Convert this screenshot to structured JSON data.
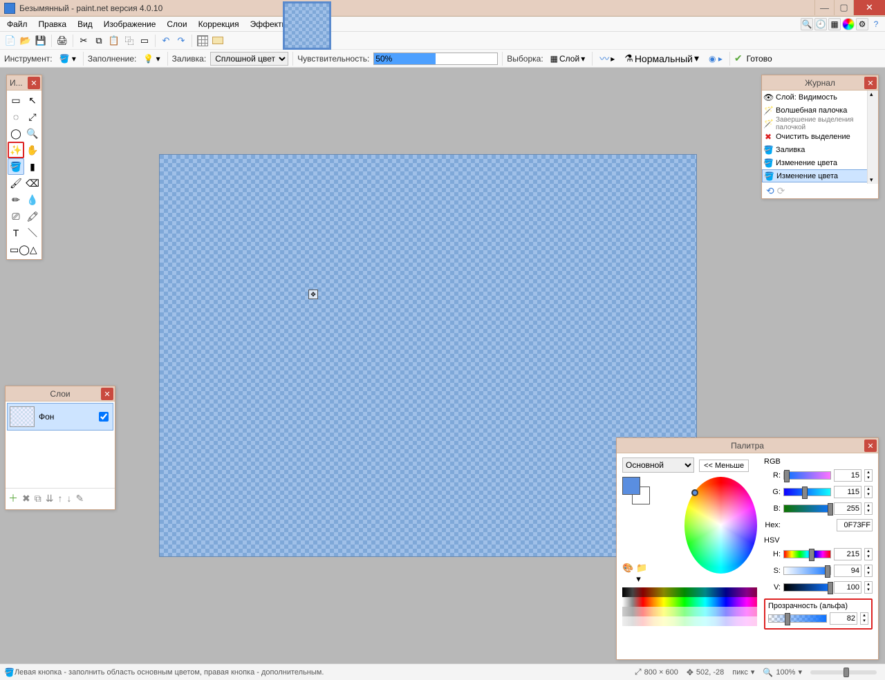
{
  "title": "Безымянный - paint.net версия 4.0.10",
  "menu": [
    "Файл",
    "Правка",
    "Вид",
    "Изображение",
    "Слои",
    "Коррекция",
    "Эффекты"
  ],
  "toolbar2": {
    "tool_label": "Инструмент:",
    "fillmode_label": "Заполнение:",
    "fill_label": "Заливка:",
    "fill_value": "Сплошной цвет",
    "tolerance_label": "Чувствительность:",
    "tolerance_value": "50%",
    "sampling_label": "Выборка:",
    "sampling_value": "Слой",
    "blend_value": "Нормальный",
    "done": "Готово"
  },
  "tools_title": "И...",
  "layers": {
    "title": "Слои",
    "bg": "Фон"
  },
  "history": {
    "title": "Журнал",
    "items": [
      {
        "icon": "👁",
        "text": "Слой: Видимость"
      },
      {
        "icon": "✒",
        "text": "Волшебная палочка"
      },
      {
        "icon": "✒",
        "text": "Завершение выделения палочкой",
        "small": true
      },
      {
        "icon": "✖",
        "text": "Очистить выделение",
        "red": true
      },
      {
        "icon": "🪣",
        "text": "Заливка"
      },
      {
        "icon": "🪣",
        "text": "Изменение цвета"
      },
      {
        "icon": "🪣",
        "text": "Изменение цвета",
        "sel": true
      }
    ]
  },
  "colors": {
    "title": "Палитра",
    "primary": "Основной",
    "less": "<< Меньше",
    "rgb": "RGB",
    "hsv": "HSV",
    "r_lab": "R:",
    "g_lab": "G:",
    "b_lab": "B:",
    "hex_lab": "Hex:",
    "h_lab": "H:",
    "s_lab": "S:",
    "v_lab": "V:",
    "r": "15",
    "g": "115",
    "b": "255",
    "hex": "0F73FF",
    "h": "215",
    "s": "94",
    "v": "100",
    "alpha_label": "Прозрачность (альфа)",
    "alpha": "82"
  },
  "status": {
    "hint": "Левая кнопка - заполнить область основным цветом, правая кнопка - дополнительным.",
    "size": "800 × 600",
    "pos": "502, -28",
    "unit": "пикс",
    "zoom": "100%"
  }
}
